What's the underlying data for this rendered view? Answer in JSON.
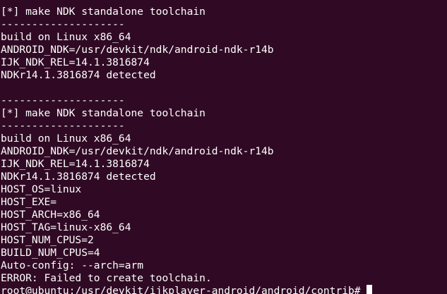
{
  "terminal": {
    "lines": [
      "--------------------",
      "[*] make NDK standalone toolchain",
      "--------------------",
      "build on Linux x86_64",
      "ANDROID_NDK=/usr/devkit/ndk/android-ndk-r14b",
      "IJK_NDK_REL=14.1.3816874",
      "NDKr14.1.3816874 detected",
      "",
      "--------------------",
      "[*] make NDK standalone toolchain",
      "--------------------",
      "build on Linux x86_64",
      "ANDROID_NDK=/usr/devkit/ndk/android-ndk-r14b",
      "IJK_NDK_REL=14.1.3816874",
      "NDKr14.1.3816874 detected",
      "HOST_OS=linux",
      "HOST_EXE=",
      "HOST_ARCH=x86_64",
      "HOST_TAG=linux-x86_64",
      "HOST_NUM_CPUS=2",
      "BUILD_NUM_CPUS=4",
      "Auto-config: --arch=arm",
      "ERROR: Failed to create toolchain."
    ],
    "prompt": "root@ubuntu:/usr/devkit/ijkplayer-android/android/contrib# "
  },
  "colors": {
    "background": "#300a24",
    "text": "#ffffff"
  }
}
